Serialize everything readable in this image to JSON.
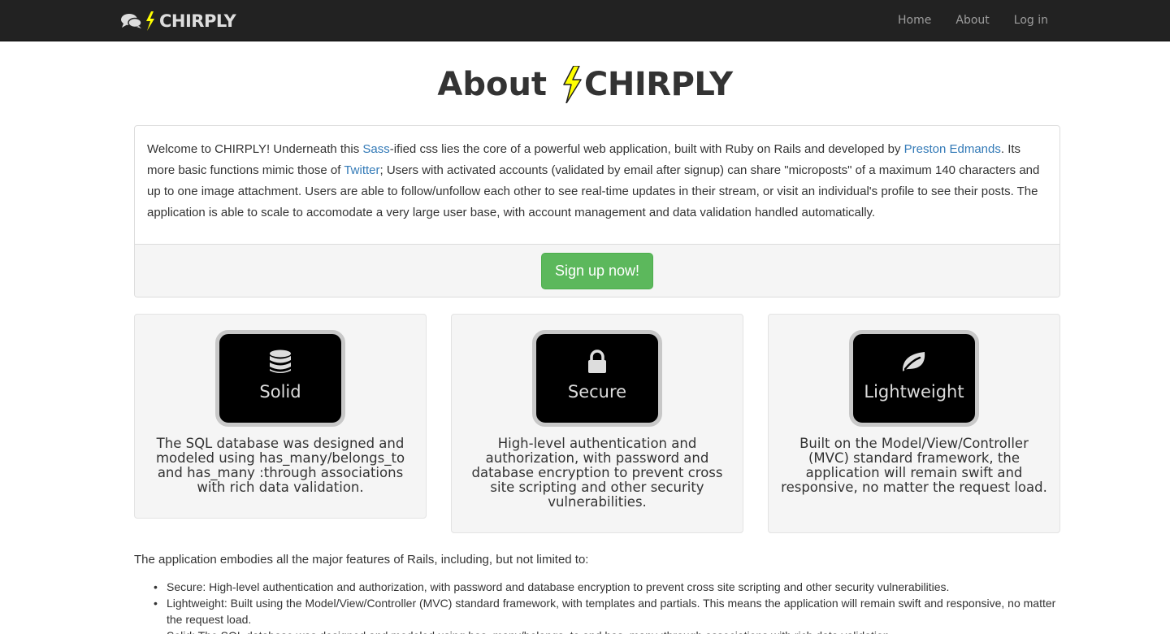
{
  "navbar": {
    "brand": "CHIRPLY",
    "links": [
      "Home",
      "About",
      "Log in"
    ]
  },
  "page": {
    "title_prefix": "About",
    "title_brand": "CHIRPLY"
  },
  "welcome": {
    "p1": "Welcome to CHIRPLY! Underneath this ",
    "sass_link": "Sass",
    "p2": "-ified css lies the core of a powerful web application, built with Ruby on Rails and developed by ",
    "author_link": "Preston Edmands",
    "p3": ". Its more basic functions mimic those of ",
    "twitter_link": "Twitter",
    "p4": "; Users with activated accounts (validated by email after signup) can share \"microposts\" of a maximum 140 characters and up to one image attachment. Users are able to follow/unfollow each other to see real-time updates in their stream, or visit an individual's profile to see their posts. The application is able to scale to accomodate a very large user base, with account management and data validation handled automatically.",
    "signup_label": "Sign up now!"
  },
  "features": [
    {
      "label": "Solid",
      "icon": "database-icon",
      "description": "The SQL database was designed and modeled using has_many/belongs_to and has_many :through associations with rich data validation."
    },
    {
      "label": "Secure",
      "icon": "lock-icon",
      "description": "High-level authentication and authorization, with password and database encryption to prevent cross site scripting and other security vulnerabilities."
    },
    {
      "label": "Lightweight",
      "icon": "leaf-icon",
      "description": "Built on the Model/View/Controller (MVC) standard framework, the application will remain swift and responsive, no matter the request load."
    }
  ],
  "rails_features": {
    "intro": "The application embodies all the major features of Rails, including, but not limited to:",
    "items": [
      "Secure: High-level authentication and authorization, with password and database encryption to prevent cross site scripting and other security vulnerabilities.",
      "Lightweight: Built using the Model/View/Controller (MVC) standard framework, with templates and partials. This means the application will remain swift and responsive, no matter the request load.",
      "Solid: The SQL database was designed and modeled using has_many/belongs_to and has_many :through associations with rich data validation."
    ]
  },
  "colors": {
    "navbar_bg": "#222222",
    "link": "#337ab7",
    "success": "#5cb85c",
    "bolt": "#ffff00"
  }
}
